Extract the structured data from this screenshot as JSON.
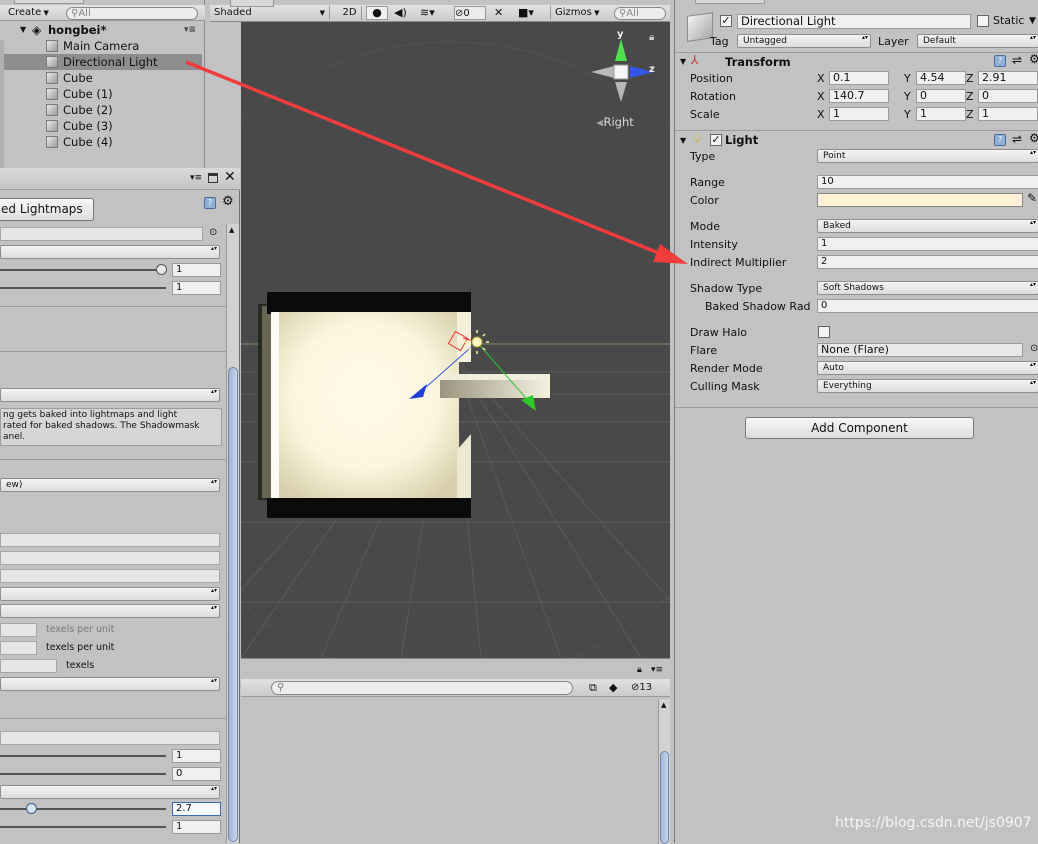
{
  "hierarchy": {
    "create_label": "Create",
    "search_placeholder": "All",
    "scene_name": "hongbei*",
    "items": [
      "Main Camera",
      "Directional Light",
      "Cube",
      "Cube (1)",
      "Cube (2)",
      "Cube (3)",
      "Cube (4)"
    ],
    "selected_index": 1
  },
  "scene_toolbar": {
    "shading_mode": "Shaded",
    "mode_2d": "2D",
    "effects_count": "0",
    "gizmos_label": "Gizmos",
    "search_placeholder": "All"
  },
  "scene_view": {
    "gizmo_y": "y",
    "gizmo_z": "z",
    "view_label": "Right"
  },
  "lighting_window": {
    "generate_button": "ed Lightmaps",
    "field_value_1": "1",
    "field_value_2": "1",
    "info_text": "ng gets baked into lightmaps and light\nrated for baked shadows. The Shadowmask\nanel.",
    "dropdown_text": "ew)",
    "texels_per_unit_1": "texels per unit",
    "texels_per_unit_2": "texels per unit",
    "texels": "texels",
    "value_a": "1",
    "value_b": "0",
    "value_c": "2.7",
    "value_d": "1"
  },
  "console": {
    "count": "13"
  },
  "inspector": {
    "object_name": "Directional Light",
    "static_label": "Static",
    "tag_label": "Tag",
    "tag_value": "Untagged",
    "layer_label": "Layer",
    "layer_value": "Default",
    "transform": {
      "title": "Transform",
      "position_label": "Position",
      "rotation_label": "Rotation",
      "scale_label": "Scale",
      "position": {
        "x": "0.1",
        "y": "4.54",
        "z": "2.91"
      },
      "rotation": {
        "x": "140.7",
        "y": "0",
        "z": "0"
      },
      "scale": {
        "x": "1",
        "y": "1",
        "z": "1"
      },
      "x_label": "X",
      "y_label": "Y",
      "z_label": "Z"
    },
    "light": {
      "title": "Light",
      "type_label": "Type",
      "type_value": "Point",
      "range_label": "Range",
      "range_value": "10",
      "color_label": "Color",
      "color_value": "#fdf2d6",
      "mode_label": "Mode",
      "mode_value": "Baked",
      "intensity_label": "Intensity",
      "intensity_value": "1",
      "indirect_label": "Indirect Multiplier",
      "indirect_value": "2",
      "shadow_type_label": "Shadow Type",
      "shadow_type_value": "Soft Shadows",
      "baked_radius_label": "Baked Shadow Rad",
      "baked_radius_value": "0",
      "draw_halo_label": "Draw Halo",
      "flare_label": "Flare",
      "flare_value": "None (Flare)",
      "render_mode_label": "Render Mode",
      "render_mode_value": "Auto",
      "culling_label": "Culling Mask",
      "culling_value": "Everything"
    },
    "add_component": "Add Component"
  },
  "watermark": "https://blog.csdn.net/js0907",
  "colors": {
    "scene_bg": "#494949",
    "panel_bg": "#c2c2c2",
    "selection": "#8e8e8e",
    "annotation_arrow": "#f03c3c"
  }
}
